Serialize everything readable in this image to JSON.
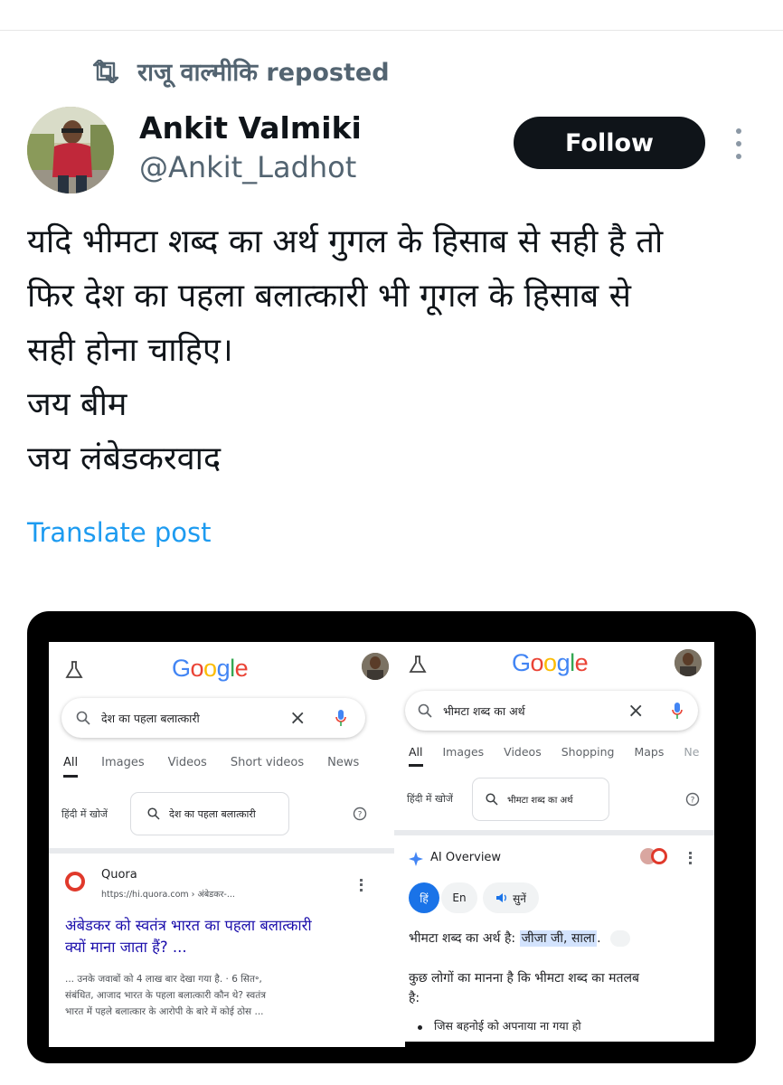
{
  "repost": {
    "label": "राजू वाल्मीकि reposted"
  },
  "author": {
    "name": "Ankit Valmiki",
    "handle": "@Ankit_Ladhot"
  },
  "follow_label": "Follow",
  "post": {
    "lines": [
      "यदि भीमटा शब्द का अर्थ गुगल के हिसाब से सही है तो",
      "फिर देश का पहला बलात्कारी भी गूगल के हिसाब से",
      "सही होना चाहिए।",
      "जय बीम",
      "जय लंबेडकरवाद"
    ]
  },
  "translate_label": "Translate post",
  "left_shot": {
    "logo": "Google",
    "query": "देश का पहला बलात्कारी",
    "tabs": [
      "All",
      "Images",
      "Videos",
      "Short videos",
      "News"
    ],
    "hindi_label": "हिंदी में खोजें",
    "hindi_query": "देश का पहला बलात्कारी",
    "source_name": "Quora",
    "source_url": "https://hi.quora.com › अंबेडकर-...",
    "result_title_1": "अंबेडकर को स्वतंत्र भारत का पहला बलात्कारी",
    "result_title_2": "क्यों माना जाता हैं? ...",
    "snippet_1": "... उनके जवाबों को 4 लाख बार देखा गया है. · 6 सित॰,",
    "snippet_2": "संबंधित, आजाद भारत के पहला बलात्कारी कौन थे? स्वतंत्र",
    "snippet_3": "भारत में पहले बलात्कार के आरोपी के बारे में कोई ठोस ..."
  },
  "right_shot": {
    "logo": "Google",
    "query": "भीमटा शब्द का अर्थ",
    "tabs": [
      "All",
      "Images",
      "Videos",
      "Shopping",
      "Maps",
      "Ne"
    ],
    "hindi_label": "हिंदी में खोजें",
    "hindi_query": "भीमटा शब्द का अर्थ",
    "ai_label": "AI Overview",
    "lang_hi": "हिं",
    "lang_en": "En",
    "listen": "सुनें",
    "meaning_prefix": "भीमटा शब्द का अर्थ है:",
    "meaning_highlight": "जीजा जी, साला",
    "line_2": "कुछ लोगों का मानना है कि भीमटा शब्द का मतलब",
    "line_3": "है:",
    "bullet_1": "जिस बहनोई को अपनाया ना गया हो"
  }
}
